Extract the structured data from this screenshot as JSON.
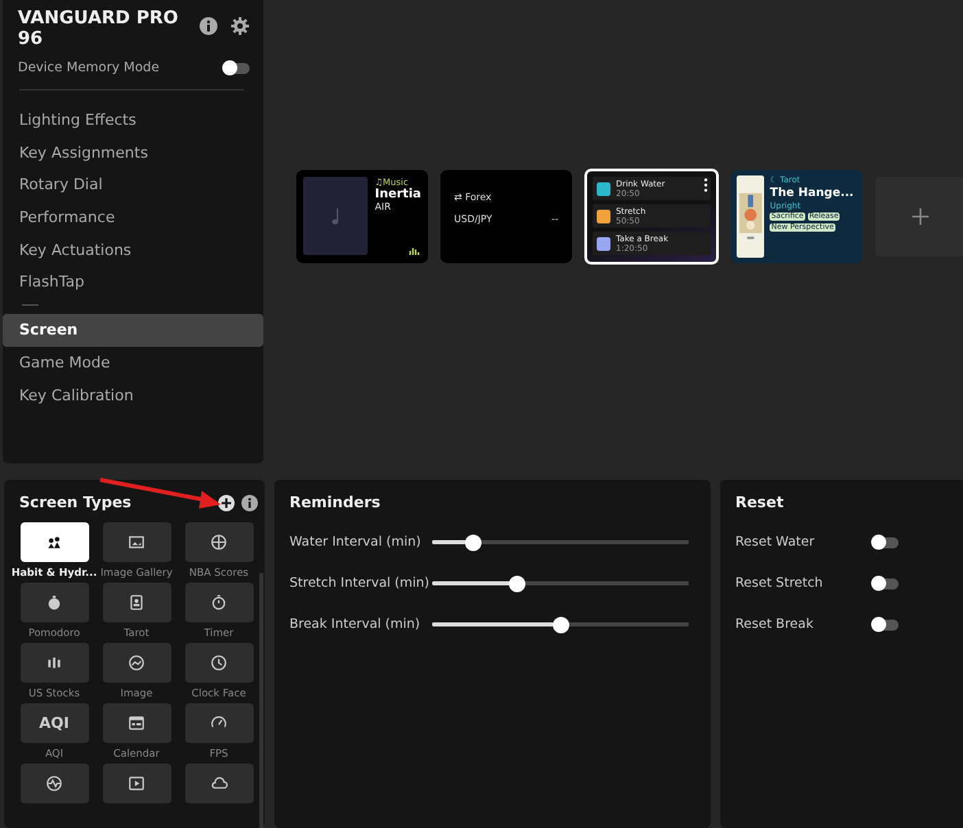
{
  "device": {
    "name": "VANGUARD PRO 96",
    "memory_mode": {
      "label": "Device Memory Mode",
      "on": false
    }
  },
  "nav": [
    {
      "label": "Lighting Effects",
      "selected": false
    },
    {
      "label": "Key Assignments",
      "selected": false
    },
    {
      "label": "Rotary Dial",
      "selected": false
    },
    {
      "label": "Performance",
      "selected": false
    },
    {
      "label": "Key Actuations",
      "selected": false
    },
    {
      "label": "FlashTap",
      "selected": false
    },
    {
      "kind": "divider"
    },
    {
      "label": "Screen",
      "selected": true
    },
    {
      "label": "Game Mode",
      "selected": false
    },
    {
      "label": "Key Calibration",
      "selected": false
    }
  ],
  "screens": [
    {
      "kind": "music",
      "selected": false,
      "tag": "♫Music",
      "title": "Inertia",
      "subtitle": "AIR"
    },
    {
      "kind": "forex",
      "selected": false,
      "tag": "⇄ Forex",
      "pair": "USD/JPY",
      "value": "--"
    },
    {
      "kind": "habit",
      "selected": true,
      "items": [
        {
          "title": "Drink Water",
          "time": "20:50",
          "color": "#2bb7c9"
        },
        {
          "title": "Stretch",
          "time": "50:50",
          "color": "#f0a23a"
        },
        {
          "title": "Take a Break",
          "time": "1:20:50",
          "color": "#9aa6f2"
        }
      ]
    },
    {
      "kind": "tarot",
      "selected": false,
      "tag": "☾ Tarot",
      "title": "The Hange...",
      "subtitle": "Upright",
      "keywords": [
        "Sacrifice",
        "Release",
        "New Perspective"
      ]
    },
    {
      "kind": "add"
    }
  ],
  "screen_types": {
    "title": "Screen Types",
    "items": [
      {
        "label": "Habit & Hydr...",
        "selected": true
      },
      {
        "label": "Image Gallery",
        "selected": false
      },
      {
        "label": "NBA Scores",
        "selected": false
      },
      {
        "label": "Pomodoro",
        "selected": false
      },
      {
        "label": "Tarot",
        "selected": false
      },
      {
        "label": "Timer",
        "selected": false
      },
      {
        "label": "US Stocks",
        "selected": false
      },
      {
        "label": "Image",
        "selected": false
      },
      {
        "label": "Clock Face",
        "selected": false
      },
      {
        "label": "AQI",
        "selected": false,
        "glyph": "AQI"
      },
      {
        "label": "Calendar",
        "selected": false
      },
      {
        "label": "FPS",
        "selected": false
      },
      {
        "selected": false
      },
      {
        "selected": false
      },
      {
        "selected": false
      }
    ]
  },
  "reminders": {
    "title": "Reminders",
    "sliders": [
      {
        "label": "Water Interval (min)",
        "level": 0.16
      },
      {
        "label": "Stretch Interval (min)",
        "level": 0.33
      },
      {
        "label": "Break Interval (min)",
        "level": 0.5
      }
    ]
  },
  "reset": {
    "title": "Reset",
    "toggles": [
      {
        "label": "Reset Water",
        "on": false
      },
      {
        "label": "Reset Stretch",
        "on": false
      },
      {
        "label": "Reset Break",
        "on": false
      }
    ]
  }
}
